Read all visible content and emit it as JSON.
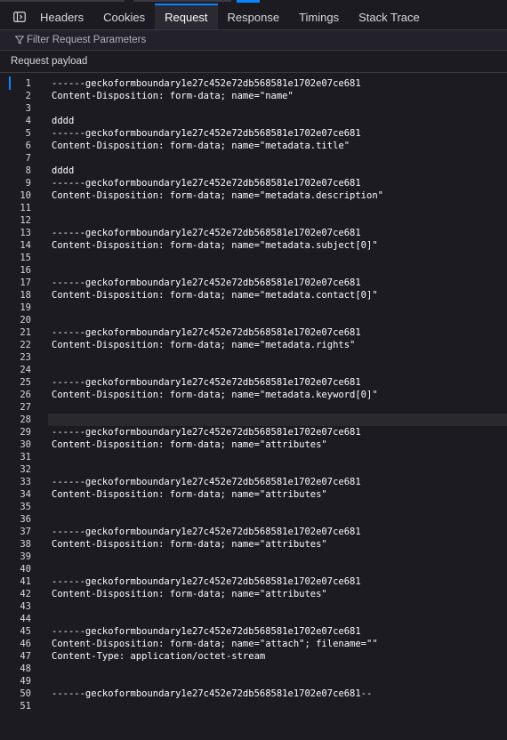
{
  "tabs": [
    {
      "label": "Headers",
      "active": false
    },
    {
      "label": "Cookies",
      "active": false
    },
    {
      "label": "Request",
      "active": true
    },
    {
      "label": "Response",
      "active": false
    },
    {
      "label": "Timings",
      "active": false
    },
    {
      "label": "Stack Trace",
      "active": false
    }
  ],
  "filter": {
    "placeholder": "Filter Request Parameters",
    "value": ""
  },
  "section": {
    "title": "Request payload"
  },
  "highlighted_line": 28,
  "colors": {
    "accent": "#0a84ff",
    "background": "#1c1b22",
    "highlight": "#2a2a2e"
  },
  "icons": {
    "panel_toggle": "sidebar-toggle-icon",
    "filter": "filter-funnel-icon"
  },
  "payload_lines": [
    "------geckoformboundary1e27c452e72db568581e1702e07ce681",
    "Content-Disposition: form-data; name=\"name\"",
    "",
    "dddd",
    "------geckoformboundary1e27c452e72db568581e1702e07ce681",
    "Content-Disposition: form-data; name=\"metadata.title\"",
    "",
    "dddd",
    "------geckoformboundary1e27c452e72db568581e1702e07ce681",
    "Content-Disposition: form-data; name=\"metadata.description\"",
    "",
    "",
    "------geckoformboundary1e27c452e72db568581e1702e07ce681",
    "Content-Disposition: form-data; name=\"metadata.subject[0]\"",
    "",
    "",
    "------geckoformboundary1e27c452e72db568581e1702e07ce681",
    "Content-Disposition: form-data; name=\"metadata.contact[0]\"",
    "",
    "",
    "------geckoformboundary1e27c452e72db568581e1702e07ce681",
    "Content-Disposition: form-data; name=\"metadata.rights\"",
    "",
    "",
    "------geckoformboundary1e27c452e72db568581e1702e07ce681",
    "Content-Disposition: form-data; name=\"metadata.keyword[0]\"",
    "",
    "",
    "------geckoformboundary1e27c452e72db568581e1702e07ce681",
    "Content-Disposition: form-data; name=\"attributes\"",
    "",
    "",
    "------geckoformboundary1e27c452e72db568581e1702e07ce681",
    "Content-Disposition: form-data; name=\"attributes\"",
    "",
    "",
    "------geckoformboundary1e27c452e72db568581e1702e07ce681",
    "Content-Disposition: form-data; name=\"attributes\"",
    "",
    "",
    "------geckoformboundary1e27c452e72db568581e1702e07ce681",
    "Content-Disposition: form-data; name=\"attributes\"",
    "",
    "",
    "------geckoformboundary1e27c452e72db568581e1702e07ce681",
    "Content-Disposition: form-data; name=\"attach\"; filename=\"\"",
    "Content-Type: application/octet-stream",
    "",
    "",
    "------geckoformboundary1e27c452e72db568581e1702e07ce681--",
    ""
  ]
}
